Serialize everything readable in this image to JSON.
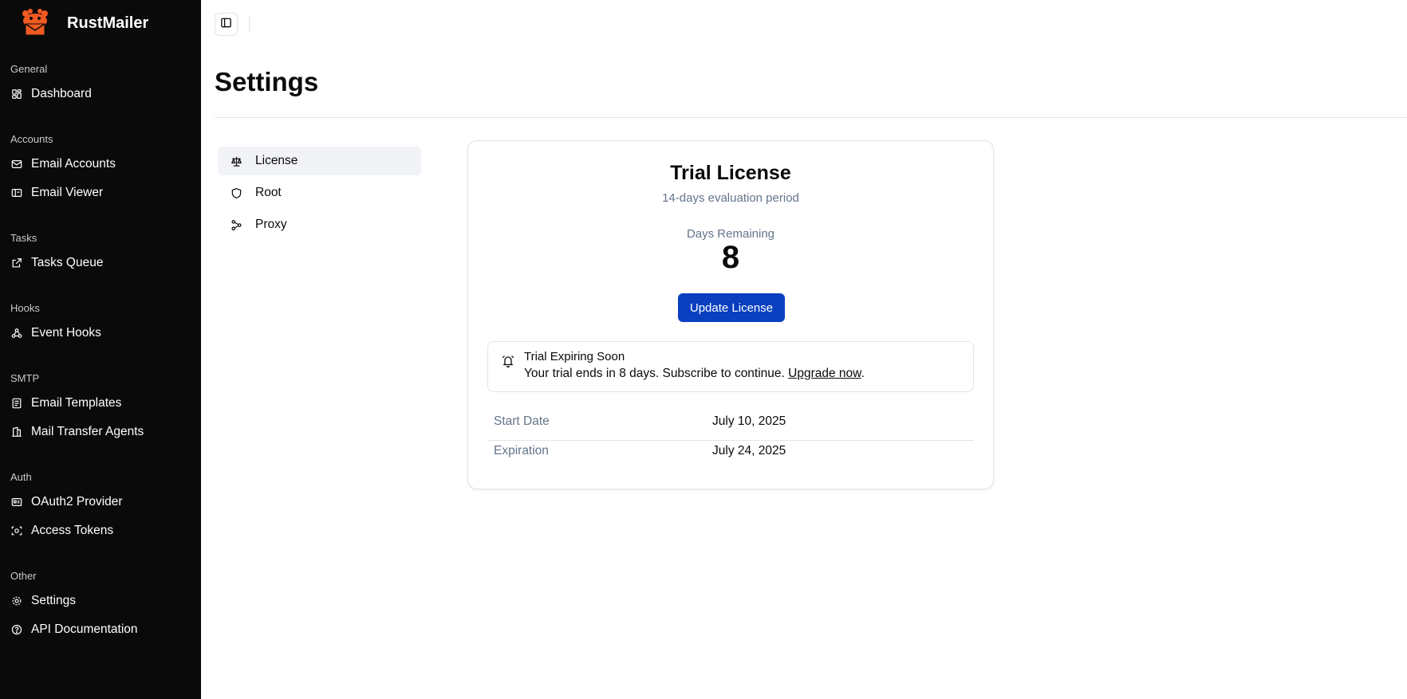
{
  "app": {
    "name": "RustMailer"
  },
  "sidebar": {
    "groups": [
      {
        "label": "General",
        "items": [
          {
            "label": "Dashboard",
            "icon": "dashboard-icon"
          }
        ]
      },
      {
        "label": "Accounts",
        "items": [
          {
            "label": "Email Accounts",
            "icon": "mail-icon"
          },
          {
            "label": "Email Viewer",
            "icon": "viewer-icon"
          }
        ]
      },
      {
        "label": "Tasks",
        "items": [
          {
            "label": "Tasks Queue",
            "icon": "external-link-icon"
          }
        ]
      },
      {
        "label": "Hooks",
        "items": [
          {
            "label": "Event Hooks",
            "icon": "webhook-icon"
          }
        ]
      },
      {
        "label": "SMTP",
        "items": [
          {
            "label": "Email Templates",
            "icon": "template-icon"
          },
          {
            "label": "Mail Transfer Agents",
            "icon": "server-icon"
          }
        ]
      },
      {
        "label": "Auth",
        "items": [
          {
            "label": "OAuth2 Provider",
            "icon": "id-card-icon"
          },
          {
            "label": "Access Tokens",
            "icon": "scan-face-icon"
          }
        ]
      },
      {
        "label": "Other",
        "items": [
          {
            "label": "Settings",
            "icon": "gear-icon"
          },
          {
            "label": "API Documentation",
            "icon": "help-circle-icon"
          }
        ]
      }
    ]
  },
  "header": {
    "toggle_icon": "sidebar-toggle-icon"
  },
  "page": {
    "title": "Settings"
  },
  "settings_nav": [
    {
      "label": "License",
      "icon": "scale-icon",
      "active": true
    },
    {
      "label": "Root",
      "icon": "shield-icon",
      "active": false
    },
    {
      "label": "Proxy",
      "icon": "network-icon",
      "active": false
    }
  ],
  "license": {
    "title": "Trial License",
    "subtitle": "14-days evaluation period",
    "days_label": "Days Remaining",
    "days_value": "8",
    "update_button": "Update License",
    "alert": {
      "title": "Trial Expiring Soon",
      "text": "Your trial ends in 8 days. Subscribe to continue.",
      "link": "Upgrade now",
      "suffix": "."
    },
    "rows": [
      {
        "label": "Start Date",
        "value": "July 10, 2025"
      },
      {
        "label": "Expiration",
        "value": "July 24, 2025"
      }
    ]
  },
  "colors": {
    "sidebar_bg": "#0a0a0a",
    "primary": "#0a3fc0",
    "muted": "#64748b",
    "brand_orange": "#f15a22"
  }
}
